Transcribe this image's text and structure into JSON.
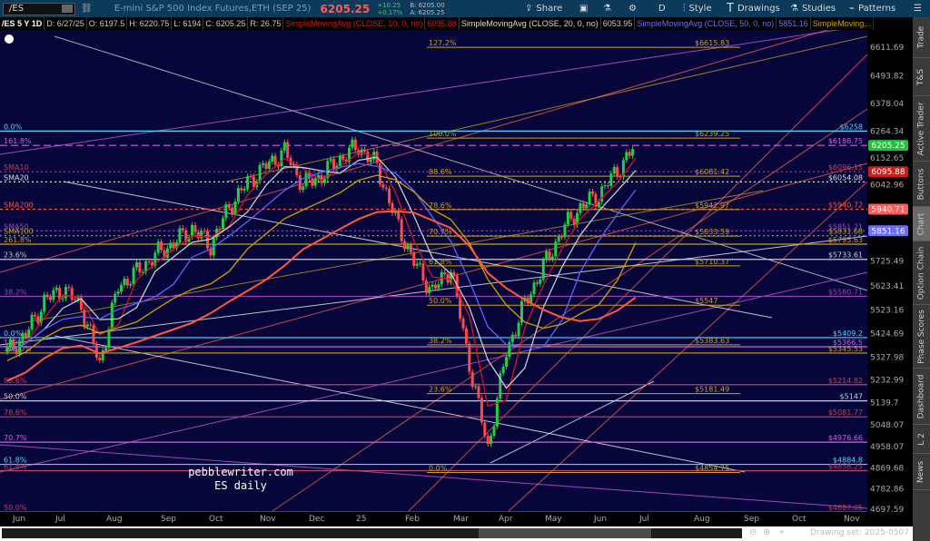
{
  "header": {
    "symbol": "/ES",
    "description": "E-mini S&P 500 Index Futures,ETH (SEP 25)",
    "last": "6205.25",
    "change": "+10.25",
    "change_pct": "+0.17%",
    "bid": "B: 6205.00",
    "ask": "A: 6205.25",
    "toolbar": {
      "share": "Share",
      "timeframe": "D",
      "style": "Style",
      "drawings": "Drawings",
      "studies": "Studies",
      "patterns": "Patterns"
    }
  },
  "info": {
    "title": "/ES 5 Y 1D",
    "date": "D: 6/27/25",
    "open": "O: 6197.5",
    "high": "H: 6220.75",
    "low": "L: 6194",
    "close": "C: 6205.25",
    "range": "R: 26.75",
    "sma10": "SimpleMovingAvg (CLOSE, 10, 0, no)",
    "sma10_val": "6095.88",
    "sma20": "SimpleMovingAvg (CLOSE, 20, 0, no)",
    "sma20_val": "6053.95",
    "sma50": "SimpleMovingAvg (CLOSE, 50, 0, no)",
    "sma50_val": "5851.16",
    "sma_more": "SimpleMoving..."
  },
  "sidebar": [
    "Trade",
    "T&S",
    "Active Trader",
    "Buttons",
    "Chart",
    "Option Chain",
    "Phase Scores",
    "Dashboard",
    "L 2",
    "News"
  ],
  "watermark": {
    "line1": "pebblewriter.com",
    "line2": "ES daily"
  },
  "drawing_set": "Drawing set: 2025-0507",
  "chart_data": {
    "type": "candlestick",
    "ylim": [
      4660,
      6680
    ],
    "yticks": [
      6611.69,
      6493.82,
      6378.04,
      6264.34,
      6152.65,
      6042.96,
      5725.49,
      5623.41,
      5523.16,
      5424.69,
      5327.98,
      5232.99,
      5139.7,
      5048.07,
      4958.07,
      4869.68,
      4782.86,
      4697.59
    ],
    "xticks": [
      "Jun",
      "Jul",
      "Aug",
      "Sep",
      "Oct",
      "Nov",
      "Dec",
      "25",
      "Feb",
      "Mar",
      "Apr",
      "May",
      "Jun",
      "Jul",
      "Aug",
      "Sep",
      "Oct",
      "Nov"
    ],
    "badges": [
      {
        "value": "6205.25",
        "color": "#1fc23a"
      },
      {
        "value": "6095.88",
        "color": "#c81e1e"
      },
      {
        "value": "5940.71",
        "color": "#ff5a5a"
      },
      {
        "value": "5851.16",
        "color": "#6c6cff"
      }
    ],
    "closes": [
      5350,
      5420,
      5560,
      5610,
      5540,
      5300,
      5620,
      5680,
      5750,
      5800,
      5860,
      5790,
      5950,
      6050,
      6120,
      6180,
      6040,
      6080,
      6150,
      6200,
      6120,
      5900,
      5720,
      5600,
      5700,
      5300,
      4950,
      5350,
      5550,
      5700,
      5850,
      5950,
      6000,
      6100,
      6205.25
    ],
    "levels": [
      {
        "price": 6264.34,
        "color": "#4fd4ff",
        "left": "0.0%",
        "right": "$6258"
      },
      {
        "price": 6205,
        "color": "#d060e0",
        "dash": "8,4",
        "left": "161.8%",
        "right": "$6188.75"
      },
      {
        "price": 6096,
        "color": "#c04060",
        "dash": "2,3",
        "left": "SMA10",
        "right": "$6096.15"
      },
      {
        "price": 6054,
        "color": "#ddd",
        "dash": "2,3",
        "left": "SMA20",
        "right": "$6054.08"
      },
      {
        "price": 5940.7,
        "color": "#ff5040",
        "dash": "3,3",
        "left": "SMA200",
        "right": "$5940.72"
      },
      {
        "price": 5851,
        "color": "#a040c0",
        "dash": "2,3",
        "left": "SMA50",
        "right": "$5851.21"
      },
      {
        "price": 5831,
        "color": "#b0b020",
        "dash": "2,3",
        "left": "SMA100",
        "right": "$5831.68"
      },
      {
        "price": 5796,
        "color": "#c8a020",
        "left": "261.8%",
        "right": "$5795.63"
      },
      {
        "price": 5733,
        "color": "#ccc",
        "left": "23.6%",
        "right": "$5733.61"
      },
      {
        "price": 5580,
        "color": "#a040c0",
        "left": "38.2%",
        "right": "$5580.71"
      },
      {
        "price": 5409,
        "color": "#4fd4ff",
        "left": "0.0%",
        "right": "$5409.2"
      },
      {
        "price": 5371,
        "color": "#d060e0",
        "left": "100%",
        "right": "$5366.5"
      },
      {
        "price": 5345,
        "color": "#c8a020",
        "left": "100.0%",
        "right": "$5345.53"
      },
      {
        "price": 5214,
        "color": "#c04060",
        "left": "88.6%",
        "right": "$5214.82"
      },
      {
        "price": 5147,
        "color": "#ccc",
        "left": "50.0%",
        "right": "$5147"
      },
      {
        "price": 5081,
        "color": "#c04060",
        "left": "78.6%",
        "right": "$5081.77"
      },
      {
        "price": 4976,
        "color": "#d060e0",
        "left": "70.7%",
        "right": "$4976.66"
      },
      {
        "price": 4884,
        "color": "#4fd4ff",
        "left": "61.8%",
        "right": "$4884.8"
      },
      {
        "price": 4858,
        "color": "#c04060",
        "left": "61.8%",
        "right": "$4858.25"
      },
      {
        "price": 4687,
        "color": "#c04060",
        "left": "50.0%",
        "right": "$4687.05"
      }
    ],
    "fibs": [
      {
        "label": "127.2%",
        "value": "$6615.83",
        "price": 6615
      },
      {
        "label": "100.0%",
        "value": "$6239.25",
        "price": 6239
      },
      {
        "label": "88.6%",
        "value": "$6081.42",
        "price": 6081
      },
      {
        "label": "78.6%",
        "value": "$5942.97",
        "price": 5943
      },
      {
        "label": "70.7%",
        "value": "$5833.59",
        "price": 5833
      },
      {
        "label": "61.8%",
        "value": "$5710.37",
        "price": 5710
      },
      {
        "label": "50.0%",
        "value": "$5547",
        "price": 5547
      },
      {
        "label": "38.2%",
        "value": "$5383.63",
        "price": 5383
      },
      {
        "label": "23.6%",
        "value": "$5181.49",
        "price": 5181
      },
      {
        "label": "0.0%",
        "value": "$4854.75",
        "price": 4854
      }
    ]
  }
}
